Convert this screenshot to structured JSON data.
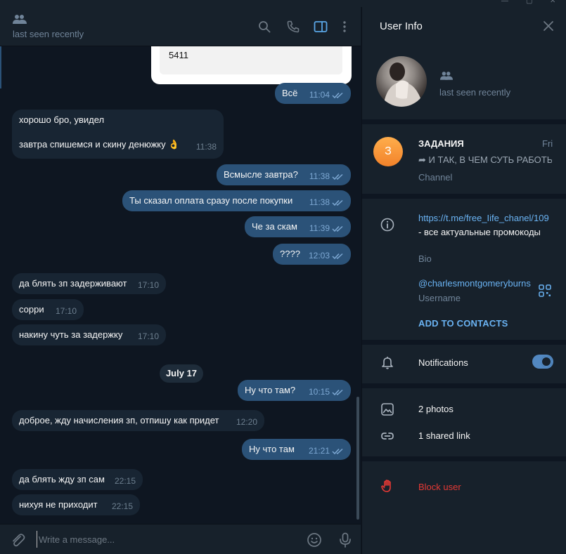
{
  "chat": {
    "header": {
      "status": "last seen recently"
    },
    "preview_number": "5411",
    "date_divider": "July 17",
    "messages": [
      {
        "dir": "out",
        "text": "Всё",
        "time": "11:04"
      },
      {
        "dir": "in",
        "text": "хорошо бро, увидел",
        "text2": "завтра спишемся и скину денюжку 👌",
        "time": "11:38"
      },
      {
        "dir": "out",
        "text": "Всмысле завтра?",
        "time": "11:38"
      },
      {
        "dir": "out",
        "text": "Ты сказал оплата сразу после покупки",
        "time": "11:38"
      },
      {
        "dir": "out",
        "text": "Че за скам",
        "time": "11:39"
      },
      {
        "dir": "out",
        "text": "????",
        "time": "12:03"
      },
      {
        "dir": "in",
        "text": "да блять зп задерживают",
        "time": "17:10"
      },
      {
        "dir": "in",
        "text": "сорри",
        "time": "17:10"
      },
      {
        "dir": "in",
        "text": "накину чуть за задержку",
        "time": "17:10"
      },
      {
        "dir": "out",
        "text": "Ну что там?",
        "time": "10:15"
      },
      {
        "dir": "in",
        "text": "доброе, жду начисления зп, отпишу как придет",
        "time": "12:20"
      },
      {
        "dir": "out",
        "text": "Ну что там",
        "time": "21:21"
      },
      {
        "dir": "in",
        "text": "да блять жду зп сам",
        "time": "22:15"
      },
      {
        "dir": "in",
        "text": "нихуя не приходит",
        "time": "22:15"
      }
    ],
    "composer": {
      "placeholder": "Write a message..."
    }
  },
  "panel": {
    "title": "User Info",
    "profile": {
      "status": "last seen recently"
    },
    "channel": {
      "avatar_letter": "З",
      "name": "ЗАДАНИЯ",
      "date": "Fri",
      "last_message": "➦ И ТАК, В ЧЕМ СУТЬ РАБОТЫ",
      "type": "Channel"
    },
    "bio": {
      "link": "https://t.me/free_Iife_chanel/109",
      "text": " - все актуальные промокоды",
      "caption": "Bio"
    },
    "username": {
      "value": "@charlesmontgomeryburns",
      "caption": "Username"
    },
    "add_contacts": "ADD TO CONTACTS",
    "notifications": {
      "label": "Notifications",
      "enabled": true
    },
    "photos": "2 photos",
    "shared_links": "1 shared link",
    "block": "Block user"
  },
  "colors": {
    "background": "#0e1621",
    "panel": "#17212b",
    "incoming_bubble": "#182533",
    "outgoing_bubble": "#2b5278",
    "accent": "#6ab3f3",
    "danger": "#e53935"
  }
}
